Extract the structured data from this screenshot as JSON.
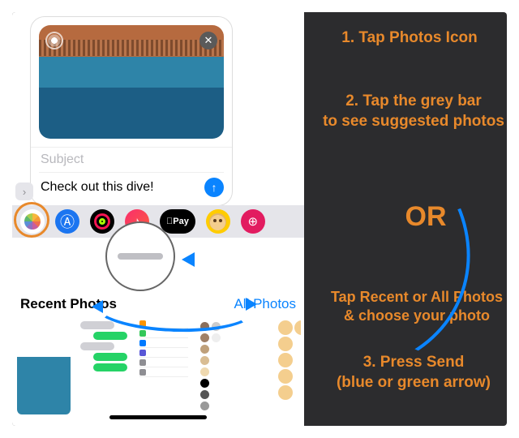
{
  "instructions": {
    "step1": "1. Tap Photos Icon",
    "step2_a": "2. Tap the grey bar",
    "step2_b": "to see suggested photos",
    "or": "OR",
    "step_alt_a": "Tap Recent or All Photos",
    "step_alt_b": "& choose your photo",
    "step3_a": "3. Press Send",
    "step3_b": "(blue or green arrow)"
  },
  "message": {
    "subject_placeholder": "Subject",
    "compose_text": "Check out this dive!"
  },
  "drawer": {
    "pay_label": "Pay"
  },
  "gallery": {
    "recent_label": "Recent Photos",
    "all_label": "All Photos"
  },
  "colors": {
    "accent_orange": "#e8892b",
    "arrow_blue": "#0a84ff"
  }
}
